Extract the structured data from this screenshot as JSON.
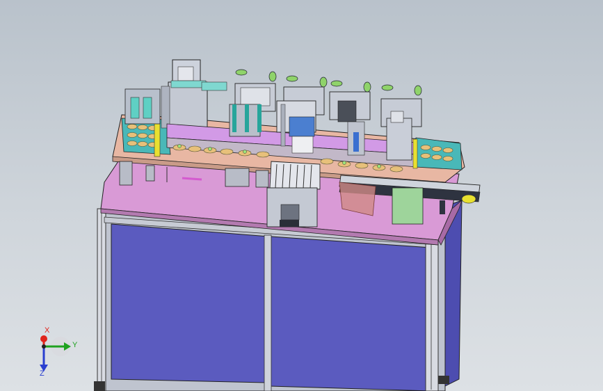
{
  "viewport": {
    "background_top": "#b9c2cb",
    "background_bottom": "#dde1e5"
  },
  "model": {
    "cabinet_color": "#5b5bbf",
    "table_top_color": "#d99ad6",
    "frame_color": "#c9cdd6",
    "fixture_color": "#a9aebb"
  },
  "triad": {
    "x_label": "X",
    "y_label": "Y",
    "z_label": "Z",
    "x_color": "#e0241b",
    "y_color": "#1fa21f",
    "z_color": "#2a3fd0",
    "icon": "axis-triad-icon"
  }
}
